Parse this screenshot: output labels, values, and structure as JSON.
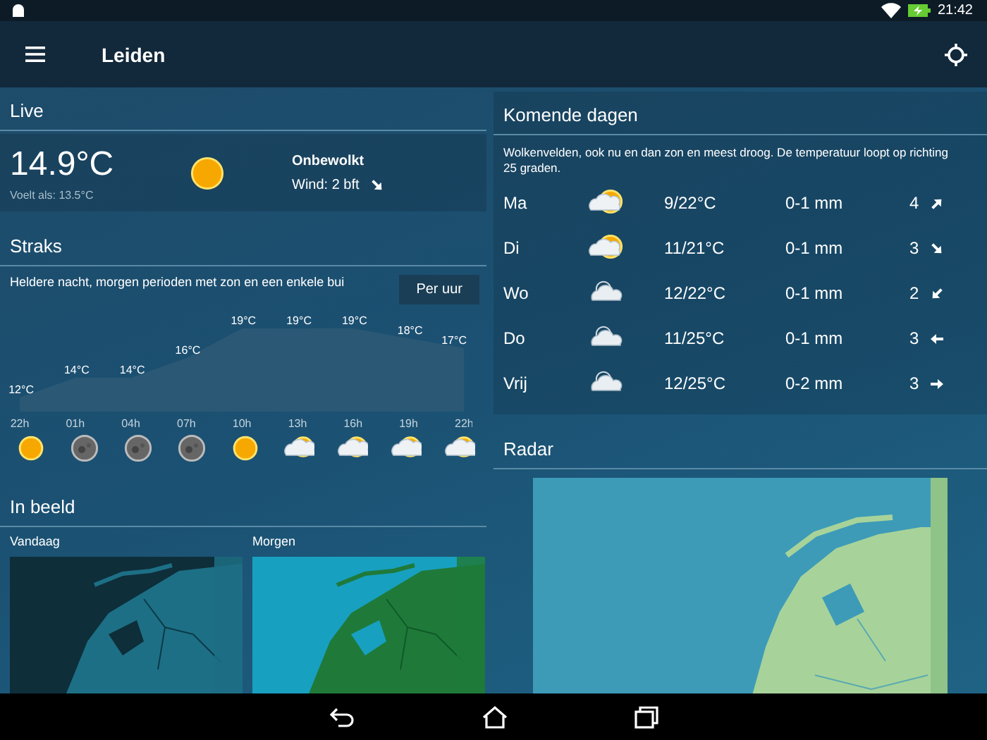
{
  "status_bar": {
    "time": "21:42"
  },
  "app_bar": {
    "title": "Leiden"
  },
  "live": {
    "title": "Live",
    "temperature": "14.9°C",
    "feels_like": "Voelt als: 13.5°C",
    "kind": "sun",
    "condition": "Onbewolkt",
    "wind": {
      "text": "Wind: 2 bft",
      "kind": "SE"
    }
  },
  "straks": {
    "title": "Straks",
    "description": "Heldere nacht, morgen perioden met zon en een enkele bui",
    "button": "Per uur",
    "chart_data": {
      "type": "area",
      "categories": [
        "22h",
        "01h",
        "04h",
        "07h",
        "10h",
        "13h",
        "16h",
        "19h",
        "22h"
      ],
      "ylabel": "°C",
      "series": [
        {
          "color": "#2a5875",
          "values": [
            12,
            14,
            14,
            16,
            19,
            19,
            19,
            18,
            17
          ]
        }
      ],
      "data_labels": true
    },
    "hour_icons": [
      {
        "kind": "sun"
      },
      {
        "kind": "moon"
      },
      {
        "kind": "moon"
      },
      {
        "kind": "moon"
      },
      {
        "kind": "sun"
      },
      {
        "kind": "partly-cloudy"
      },
      {
        "kind": "partly-cloudy"
      },
      {
        "kind": "partly-cloudy"
      },
      {
        "kind": "partly-cloudy"
      }
    ]
  },
  "in_beeld": {
    "title": "In beeld",
    "maps": [
      {
        "label": "Vandaag",
        "kind": "night"
      },
      {
        "label": "Morgen",
        "kind": "day"
      }
    ]
  },
  "komende_dagen": {
    "title": "Komende dagen",
    "description": "Wolkenvelden, ook nu en dan zon en meest droog. De temperatuur loopt op richting 25 graden.",
    "days": [
      {
        "day": "Ma",
        "kind": "partly-cloudy",
        "temperature": "9/22°C",
        "precipitation": "0-1 mm",
        "wind": {
          "text": "4",
          "kind": "NE"
        }
      },
      {
        "day": "Di",
        "kind": "partly-cloudy",
        "temperature": "11/21°C",
        "precipitation": "0-1 mm",
        "wind": {
          "text": "3",
          "kind": "SE"
        }
      },
      {
        "day": "Wo",
        "kind": "cloudy",
        "temperature": "12/22°C",
        "precipitation": "0-1 mm",
        "wind": {
          "text": "2",
          "kind": "SW"
        }
      },
      {
        "day": "Do",
        "kind": "cloudy",
        "temperature": "11/25°C",
        "precipitation": "0-1 mm",
        "wind": {
          "text": "3",
          "kind": "W"
        }
      },
      {
        "day": "Vrij",
        "kind": "cloudy",
        "temperature": "12/25°C",
        "precipitation": "0-2 mm",
        "wind": {
          "text": "3",
          "kind": "E"
        }
      }
    ]
  },
  "radar": {
    "title": "Radar"
  }
}
